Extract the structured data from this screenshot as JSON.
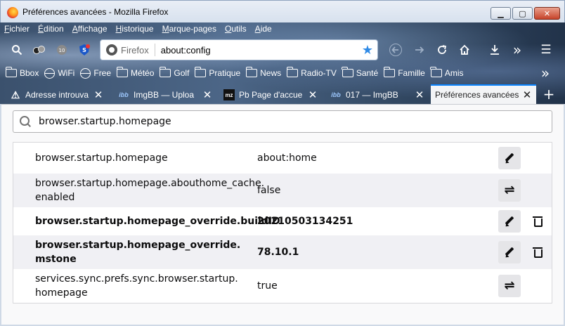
{
  "window": {
    "title": "Préférences avancées - Mozilla Firefox",
    "minimize": "▁",
    "maximize": "▢",
    "close": "✕"
  },
  "menubar": [
    {
      "u": "F",
      "rest": "ichier"
    },
    {
      "u": "É",
      "rest": "dition"
    },
    {
      "u": "A",
      "rest": "ffichage"
    },
    {
      "u": "H",
      "rest": "istorique"
    },
    {
      "u": "M",
      "rest": "arque-pages"
    },
    {
      "u": "O",
      "rest": "utils"
    },
    {
      "u": "A",
      "rest": "ide"
    }
  ],
  "navbar": {
    "brand": "Firefox",
    "url": "about:config",
    "overflow": "»",
    "menu": "☰"
  },
  "bookmarks": [
    {
      "label": "Bbox",
      "icon": "folder"
    },
    {
      "label": "WiFi",
      "icon": "globe"
    },
    {
      "label": "Free",
      "icon": "globe"
    },
    {
      "label": "Météo",
      "icon": "folder"
    },
    {
      "label": "Golf",
      "icon": "folder"
    },
    {
      "label": "Pratique",
      "icon": "folder"
    },
    {
      "label": "News",
      "icon": "folder"
    },
    {
      "label": "Radio-TV",
      "icon": "folder"
    },
    {
      "label": "Santé",
      "icon": "folder"
    },
    {
      "label": "Famille",
      "icon": "folder"
    },
    {
      "label": "Amis",
      "icon": "folder"
    }
  ],
  "bookmarks_overflow": "»",
  "tabs": [
    {
      "label": "Adresse introuva",
      "favicon": "⚠",
      "active": false
    },
    {
      "label": "ImgBB — Uploa",
      "favicon": "ibb",
      "active": false
    },
    {
      "label": "Pb Page d'accue",
      "favicon": "mz",
      "active": false
    },
    {
      "label": "017 — ImgBB",
      "favicon": "ibb",
      "active": false
    },
    {
      "label": "Préférences avancées",
      "favicon": "",
      "active": true
    }
  ],
  "new_tab": "+",
  "search": {
    "value": "browser.startup.homepage"
  },
  "prefs": [
    {
      "name": "browser.startup.homepage",
      "value": "about:home",
      "modified": false,
      "type": "string",
      "action": "edit",
      "deletable": false
    },
    {
      "name": "browser.startup.homepage.abouthome_cache.enabled",
      "name_lines": [
        "browser.startup.homepage.abouthome_cache.",
        "enabled"
      ],
      "value": "false",
      "modified": false,
      "type": "boolean",
      "action": "toggle",
      "deletable": false
    },
    {
      "name": "browser.startup.homepage_override.buildID",
      "value": "20210503134251",
      "modified": true,
      "type": "string",
      "action": "edit",
      "deletable": true
    },
    {
      "name": "browser.startup.homepage_override.mstone",
      "name_lines": [
        "browser.startup.homepage_override.",
        "mstone"
      ],
      "value": "78.10.1",
      "modified": true,
      "type": "string",
      "action": "edit",
      "deletable": true
    },
    {
      "name": "services.sync.prefs.sync.browser.startup.homepage",
      "name_lines": [
        "services.sync.prefs.sync.browser.startup.",
        "homepage"
      ],
      "value": "true",
      "modified": false,
      "type": "boolean",
      "action": "toggle",
      "deletable": false
    }
  ]
}
